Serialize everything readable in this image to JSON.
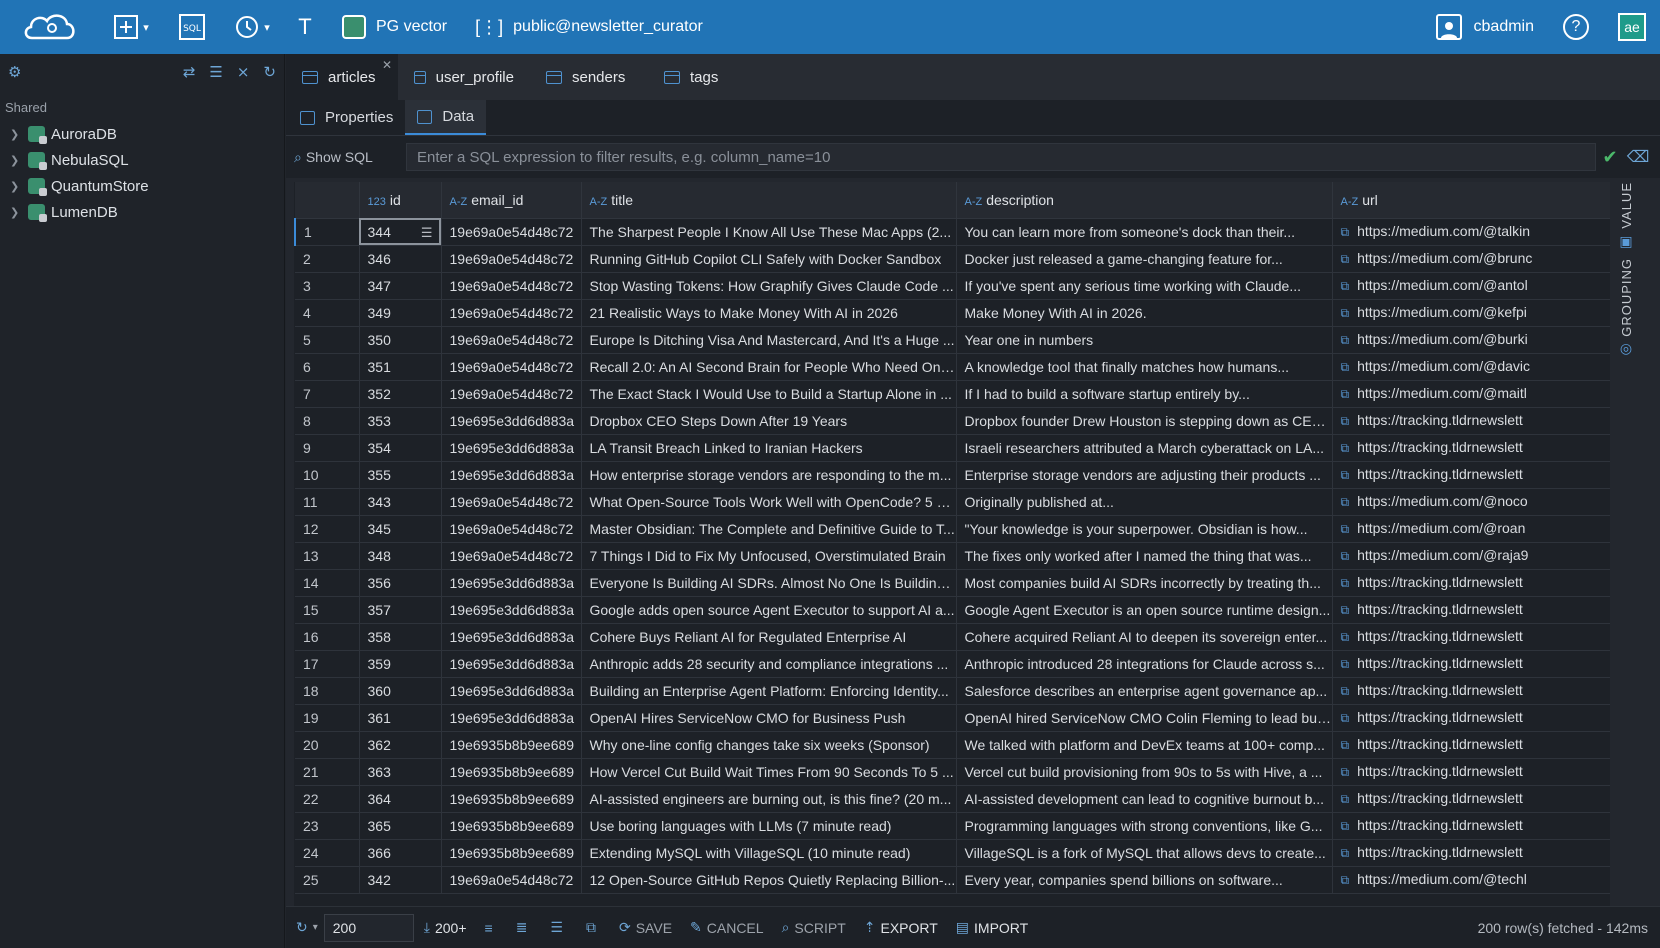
{
  "topbar": {
    "connection": "PG vector",
    "schema": "public@newsletter_curator",
    "user": "cbadmin"
  },
  "sidebar": {
    "section": "Shared",
    "items": [
      {
        "label": "AuroraDB"
      },
      {
        "label": "NebulaSQL"
      },
      {
        "label": "QuantumStore"
      },
      {
        "label": "LumenDB"
      }
    ]
  },
  "tabs": [
    {
      "label": "articles",
      "active": true
    },
    {
      "label": "user_profile"
    },
    {
      "label": "senders"
    },
    {
      "label": "tags"
    }
  ],
  "subtabs": [
    {
      "label": "Properties"
    },
    {
      "label": "Data",
      "active": true
    }
  ],
  "filter": {
    "show_sql": "Show SQL",
    "placeholder": "Enter a SQL expression to filter results, e.g. column_name=10"
  },
  "grid": {
    "columns": [
      {
        "type": "123",
        "name": "id"
      },
      {
        "type": "A-Z",
        "name": "email_id"
      },
      {
        "type": "A-Z",
        "name": "title"
      },
      {
        "type": "A-Z",
        "name": "description"
      },
      {
        "type": "A-Z",
        "name": "url"
      }
    ],
    "rows": [
      [
        "1",
        "344",
        "19e69a0e54d48c72",
        "The Sharpest People I Know All Use These Mac Apps (2...",
        "You can learn more from someone's dock than their...",
        "https://medium.com/@talkin"
      ],
      [
        "2",
        "346",
        "19e69a0e54d48c72",
        "Running GitHub Copilot CLI Safely with Docker Sandbox",
        "Docker just released a game-changing feature for...",
        "https://medium.com/@brunc"
      ],
      [
        "3",
        "347",
        "19e69a0e54d48c72",
        "Stop Wasting Tokens: How Graphify Gives Claude Code ...",
        "If you've spent any serious time working with Claude...",
        "https://medium.com/@antol"
      ],
      [
        "4",
        "349",
        "19e69a0e54d48c72",
        "21 Realistic Ways to Make Money With AI in 2026",
        "Make Money With AI in 2026.",
        "https://medium.com/@kefpi"
      ],
      [
        "5",
        "350",
        "19e69a0e54d48c72",
        "Europe Is Ditching Visa And Mastercard, And It's a Huge ...",
        "Year one in numbers",
        "https://medium.com/@burki"
      ],
      [
        "6",
        "351",
        "19e69a0e54d48c72",
        "Recall 2.0: An AI Second Brain for People Who Need One...",
        "A knowledge tool that finally matches how humans...",
        "https://medium.com/@davic"
      ],
      [
        "7",
        "352",
        "19e69a0e54d48c72",
        "The Exact Stack I Would Use to Build a Startup Alone in ...",
        "If I had to build a software startup entirely by...",
        "https://medium.com/@maitl"
      ],
      [
        "8",
        "353",
        "19e695e3dd6d883a",
        "Dropbox CEO Steps Down After 19 Years",
        "Dropbox founder Drew Houston is stepping down as CEO...",
        "https://tracking.tldrnewslett"
      ],
      [
        "9",
        "354",
        "19e695e3dd6d883a",
        "LA Transit Breach Linked to Iranian Hackers",
        "Israeli researchers attributed a March cyberattack on LA...",
        "https://tracking.tldrnewslett"
      ],
      [
        "10",
        "355",
        "19e695e3dd6d883a",
        "How enterprise storage vendors are responding to the m...",
        "Enterprise storage vendors are adjusting their products ...",
        "https://tracking.tldrnewslett"
      ],
      [
        "11",
        "343",
        "19e69a0e54d48c72",
        "What Open-Source Tools Work Well with OpenCode? 5 Pr...",
        "Originally published at...",
        "https://medium.com/@noco"
      ],
      [
        "12",
        "345",
        "19e69a0e54d48c72",
        "Master Obsidian: The Complete and Definitive Guide to T...",
        "\"Your knowledge is your superpower. Obsidian is how...",
        "https://medium.com/@roan"
      ],
      [
        "13",
        "348",
        "19e69a0e54d48c72",
        "7 Things I Did to Fix My Unfocused, Overstimulated Brain",
        "The fixes only worked after I named the thing that was...",
        "https://medium.com/@raja9"
      ],
      [
        "14",
        "356",
        "19e695e3dd6d883a",
        "Everyone Is Building AI SDRs. Almost No One Is Building ...",
        "Most companies build AI SDRs incorrectly by treating th...",
        "https://tracking.tldrnewslett"
      ],
      [
        "15",
        "357",
        "19e695e3dd6d883a",
        "Google adds open source Agent Executor to support AI a...",
        "Google Agent Executor is an open source runtime design...",
        "https://tracking.tldrnewslett"
      ],
      [
        "16",
        "358",
        "19e695e3dd6d883a",
        "Cohere Buys Reliant AI for Regulated Enterprise AI",
        "Cohere acquired Reliant AI to deepen its sovereign enter...",
        "https://tracking.tldrnewslett"
      ],
      [
        "17",
        "359",
        "19e695e3dd6d883a",
        "Anthropic adds 28 security and compliance integrations ...",
        "Anthropic introduced 28 integrations for Claude across s...",
        "https://tracking.tldrnewslett"
      ],
      [
        "18",
        "360",
        "19e695e3dd6d883a",
        "Building an Enterprise Agent Platform: Enforcing Identity...",
        "Salesforce describes an enterprise agent governance ap...",
        "https://tracking.tldrnewslett"
      ],
      [
        "19",
        "361",
        "19e695e3dd6d883a",
        "OpenAI Hires ServiceNow CMO for Business Push",
        "OpenAI hired ServiceNow CMO Colin Fleming to lead bus...",
        "https://tracking.tldrnewslett"
      ],
      [
        "20",
        "362",
        "19e6935b8b9ee689",
        "Why one-line config changes take six weeks (Sponsor)",
        "We talked with platform and DevEx teams at 100+ comp...",
        "https://tracking.tldrnewslett"
      ],
      [
        "21",
        "363",
        "19e6935b8b9ee689",
        "How Vercel Cut Build Wait Times From 90 Seconds To 5 ...",
        "Vercel cut build provisioning from 90s to 5s with Hive, a ...",
        "https://tracking.tldrnewslett"
      ],
      [
        "22",
        "364",
        "19e6935b8b9ee689",
        "AI-assisted engineers are burning out, is this fine? (20 m...",
        "AI-assisted development can lead to cognitive burnout b...",
        "https://tracking.tldrnewslett"
      ],
      [
        "23",
        "365",
        "19e6935b8b9ee689",
        "Use boring languages with LLMs (7 minute read)",
        "Programming languages with strong conventions, like G...",
        "https://tracking.tldrnewslett"
      ],
      [
        "24",
        "366",
        "19e6935b8b9ee689",
        "Extending MySQL with VillageSQL (10 minute read)",
        "VillageSQL is a fork of MySQL that allows devs to create...",
        "https://tracking.tldrnewslett"
      ],
      [
        "25",
        "342",
        "19e69a0e54d48c72",
        "12 Open-Source GitHub Repos Quietly Replacing Billion-...",
        "Every year, companies spend billions on software...",
        "https://medium.com/@techl"
      ]
    ]
  },
  "right_panel": {
    "value": "VALUE",
    "grouping": "GROUPING"
  },
  "bottombar": {
    "limit": "200",
    "fetch_more": "200+",
    "save": "SAVE",
    "cancel": "CANCEL",
    "script": "SCRIPT",
    "export": "EXPORT",
    "import": "IMPORT",
    "status": "200 row(s) fetched - 142ms"
  }
}
